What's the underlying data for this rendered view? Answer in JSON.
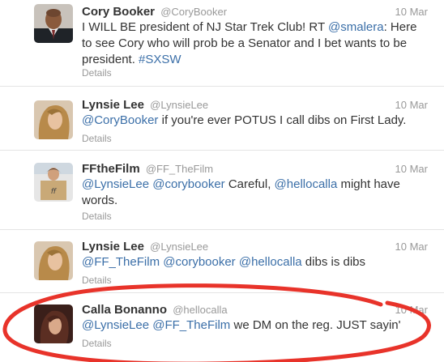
{
  "tweets": [
    {
      "name": "Cory Booker",
      "handle": "@CoryBooker",
      "time": "10 Mar",
      "text_parts": [
        "I WILL BE president of NJ Star Trek Club! RT ",
        "@smalera",
        ": Here to see Cory who will prob be a Senator and I bet wants to be president. ",
        "#SXSW"
      ],
      "details": "Details"
    },
    {
      "name": "Lynsie Lee",
      "handle": "@LynsieLee",
      "time": "10 Mar",
      "text_parts": [
        "@CoryBooker",
        " if you're ever POTUS I call dibs on First Lady."
      ],
      "details": "Details"
    },
    {
      "name": "FFtheFilm",
      "handle": "@FF_TheFilm",
      "time": "10 Mar",
      "text_parts": [
        "@LynsieLee",
        " ",
        "@corybooker",
        " Careful, ",
        "@hellocalla",
        " might have words."
      ],
      "details": "Details"
    },
    {
      "name": "Lynsie Lee",
      "handle": "@LynsieLee",
      "time": "10 Mar",
      "text_parts": [
        "@FF_TheFilm",
        " ",
        "@corybooker",
        " ",
        "@hellocalla",
        " dibs is dibs"
      ],
      "details": "Details"
    },
    {
      "name": "Calla Bonanno",
      "handle": "@hellocalla",
      "time": "10 Mar",
      "text_parts": [
        "@LynsieLee",
        " ",
        "@FF_TheFilm",
        " we DM on the reg. JUST sayin'"
      ],
      "details": "Details"
    }
  ],
  "colors": {
    "link": "#3b6fa8",
    "name": "#333333",
    "meta": "#999999",
    "annotation": "#e8332a"
  }
}
